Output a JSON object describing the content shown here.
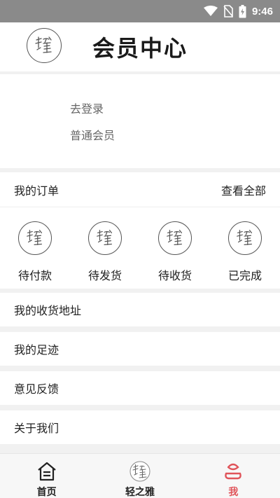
{
  "status_bar": {
    "time": "9:46",
    "icons": [
      "wifi-icon",
      "no-sim-icon",
      "battery-charging-icon"
    ]
  },
  "header": {
    "title": "会员中心"
  },
  "profile": {
    "login_label": "去登录",
    "member_level": "普通会员",
    "avatar_icon": "brand-logo-icon"
  },
  "orders": {
    "title": "我的订单",
    "view_all": "查看全部",
    "statuses": [
      {
        "label": "待付款",
        "icon": "brand-logo-icon"
      },
      {
        "label": "待发货",
        "icon": "brand-logo-icon"
      },
      {
        "label": "待收货",
        "icon": "brand-logo-icon"
      },
      {
        "label": "已完成",
        "icon": "brand-logo-icon"
      }
    ]
  },
  "menu": [
    {
      "label": "我的收货地址"
    },
    {
      "label": "我的足迹"
    },
    {
      "label": "意见反馈"
    },
    {
      "label": "关于我们"
    }
  ],
  "tab_bar": {
    "active_color": "#e0545a",
    "tabs": [
      {
        "label": "首页",
        "icon": "home-icon"
      },
      {
        "label": "轻之雅",
        "icon": "brand-logo-icon"
      },
      {
        "label": "我",
        "icon": "profile-icon"
      }
    ]
  }
}
